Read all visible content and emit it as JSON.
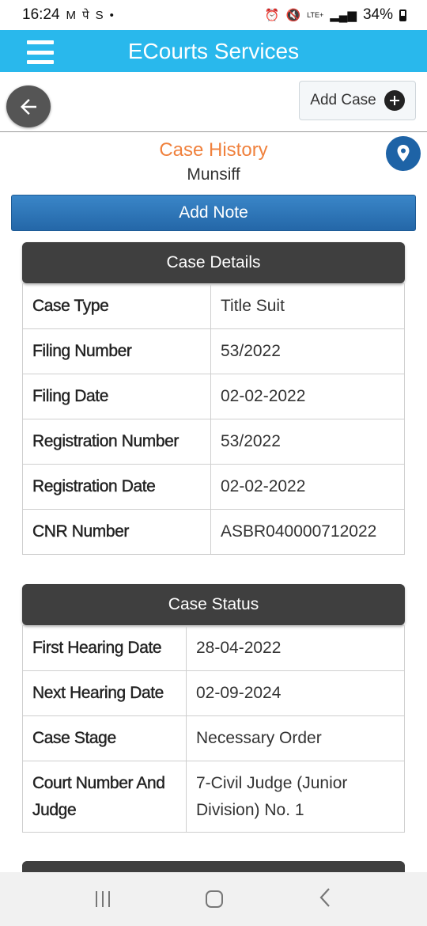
{
  "status_bar": {
    "time": "16:24",
    "battery": "34%",
    "network": "LTE+"
  },
  "app_bar": {
    "title": "ECourts Services"
  },
  "toolbar": {
    "add_case_label": "Add Case"
  },
  "case": {
    "title": "Case History",
    "court": "Munsiff"
  },
  "add_note_label": "Add Note",
  "case_details": {
    "header": "Case Details",
    "rows": [
      {
        "label": "Case Type",
        "value": "Title Suit"
      },
      {
        "label": "Filing Number",
        "value": "53/2022"
      },
      {
        "label": "Filing Date",
        "value": "02-02-2022"
      },
      {
        "label": "Registration Number",
        "value": "53/2022"
      },
      {
        "label": "Registration Date",
        "value": "02-02-2022"
      },
      {
        "label": "CNR Number",
        "value": "ASBR040000712022"
      }
    ]
  },
  "case_status": {
    "header": "Case Status",
    "rows": [
      {
        "label": "First Hearing Date",
        "value": "28-04-2022"
      },
      {
        "label": "Next Hearing Date",
        "value": "02-09-2024"
      },
      {
        "label": "Case Stage",
        "value": "Necessary Order"
      },
      {
        "label": "Court Number And Judge",
        "value": "7-Civil Judge (Junior Division) No. 1"
      }
    ]
  },
  "colors": {
    "app_bar": "#29b8ec",
    "title_accent": "#f0813d",
    "section_header": "#3f3f3f",
    "add_note": "#2a6fb0"
  }
}
